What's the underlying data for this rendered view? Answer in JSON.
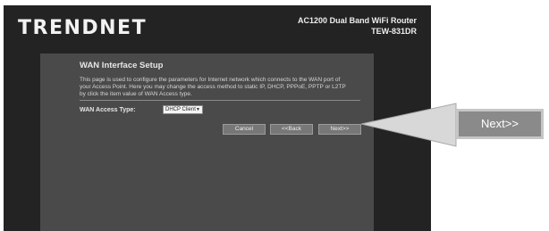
{
  "brand": "TRENDNET",
  "product": {
    "name": "AC1200 Dual Band WiFi Router",
    "model": "TEW-831DR"
  },
  "page": {
    "title": "WAN Interface Setup",
    "description": "This page is used to configure the parameters for Internet network which connects to the WAN port of your Access Point. Here you may change the access method to static IP, DHCP, PPPoE, PPTP or L2TP by click the item value of WAN Access type."
  },
  "form": {
    "wan_access_type_label": "WAN Access Type:",
    "wan_access_type_value": "DHCP Client"
  },
  "buttons": {
    "cancel": "Cancel",
    "back": "<<Back",
    "next": "Next>>"
  },
  "callout": {
    "label": "Next>>"
  },
  "colors": {
    "frame": "#232323",
    "panel": "#4a4a4a",
    "callout": "#8a8a8a"
  }
}
